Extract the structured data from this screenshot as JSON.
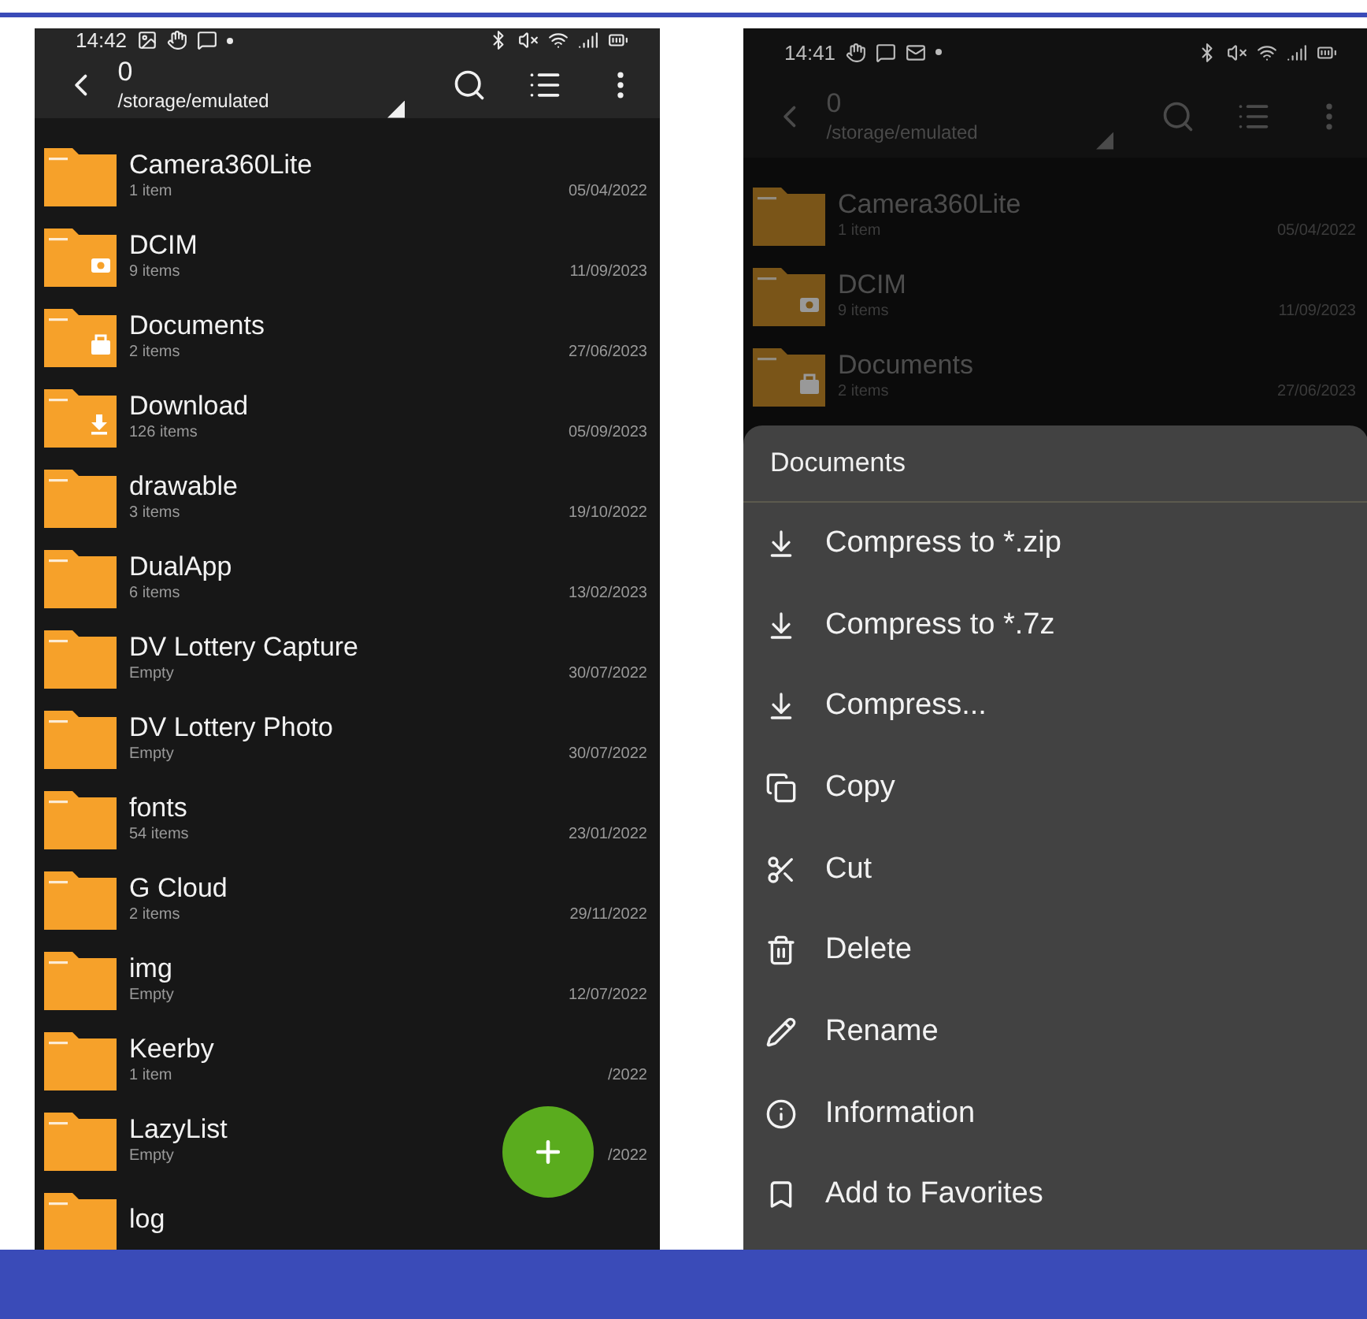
{
  "screens": [
    {
      "status_time": "14:42",
      "title": "0",
      "path": "/storage/emulated",
      "fab": true,
      "folders": [
        {
          "kind": "plain",
          "name": "Camera360Lite",
          "count": "1 item",
          "date": "05/04/2022"
        },
        {
          "kind": "camera",
          "name": "DCIM",
          "count": "9 items",
          "date": "11/09/2023"
        },
        {
          "kind": "briefcase",
          "name": "Documents",
          "count": "2 items",
          "date": "27/06/2023"
        },
        {
          "kind": "download",
          "name": "Download",
          "count": "126 items",
          "date": "05/09/2023"
        },
        {
          "kind": "plain",
          "name": "drawable",
          "count": "3 items",
          "date": "19/10/2022"
        },
        {
          "kind": "plain",
          "name": "DualApp",
          "count": "6 items",
          "date": "13/02/2023"
        },
        {
          "kind": "plain",
          "name": "DV Lottery Capture",
          "count": "Empty",
          "date": "30/07/2022"
        },
        {
          "kind": "plain",
          "name": "DV Lottery Photo",
          "count": "Empty",
          "date": "30/07/2022"
        },
        {
          "kind": "plain",
          "name": "fonts",
          "count": "54 items",
          "date": "23/01/2022"
        },
        {
          "kind": "plain",
          "name": "G Cloud",
          "count": "2 items",
          "date": "29/11/2022"
        },
        {
          "kind": "plain",
          "name": "img",
          "count": "Empty",
          "date": "12/07/2022"
        },
        {
          "kind": "plain",
          "name": "Keerby",
          "count": "1 item",
          "date": "/2022"
        },
        {
          "kind": "plain",
          "name": "LazyList",
          "count": "Empty",
          "date": "/2022"
        },
        {
          "kind": "plain",
          "name": "log"
        }
      ]
    },
    {
      "status_time": "14:41",
      "title": "0",
      "path": "/storage/emulated",
      "folders": [
        {
          "kind": "plain",
          "name": "Camera360Lite",
          "count": "1 item",
          "date": "05/04/2022"
        },
        {
          "kind": "camera",
          "name": "DCIM",
          "count": "9 items",
          "date": "11/09/2023"
        },
        {
          "kind": "briefcase",
          "name": "Documents",
          "count": "2 items",
          "date": "27/06/2023"
        }
      ],
      "sheet": {
        "title": "Documents",
        "items": [
          {
            "kind": "compress",
            "label": "Compress to *.zip"
          },
          {
            "kind": "compress",
            "label": "Compress to *.7z"
          },
          {
            "kind": "compress",
            "label": "Compress..."
          },
          {
            "kind": "copy",
            "label": "Copy"
          },
          {
            "kind": "cut",
            "label": "Cut"
          },
          {
            "kind": "delete",
            "label": "Delete"
          },
          {
            "kind": "rename",
            "label": "Rename"
          },
          {
            "kind": "info",
            "label": "Information"
          },
          {
            "kind": "favorite",
            "label": "Add to Favorites"
          }
        ]
      }
    }
  ]
}
